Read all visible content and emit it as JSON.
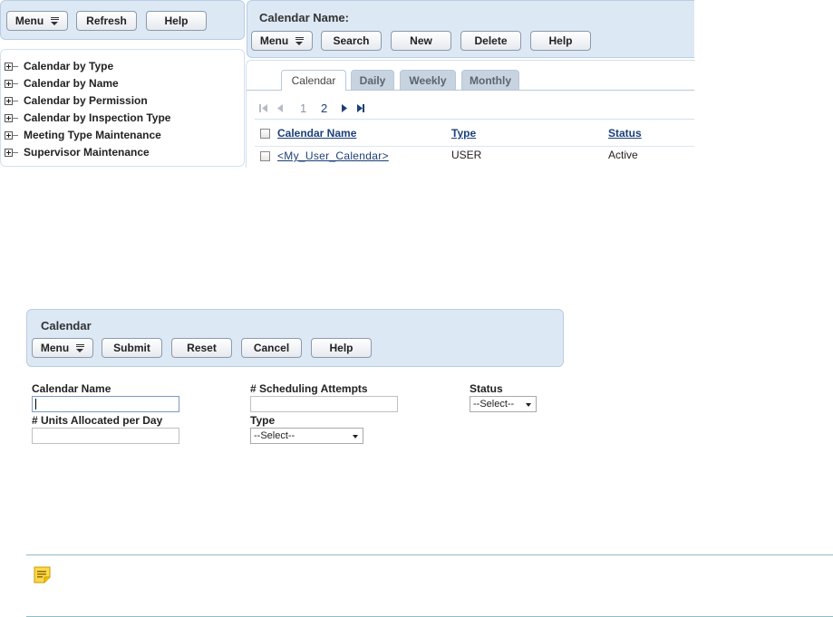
{
  "left_toolbar": {
    "menu_label": "Menu",
    "refresh_label": "Refresh",
    "help_label": "Help"
  },
  "tree": {
    "items": [
      {
        "label": "Calendar by Type"
      },
      {
        "label": "Calendar by Name"
      },
      {
        "label": "Calendar by Permission"
      },
      {
        "label": "Calendar by Inspection Type"
      },
      {
        "label": "Meeting Type Maintenance"
      },
      {
        "label": "Supervisor Maintenance"
      }
    ]
  },
  "top_panel": {
    "title": "Calendar Name:",
    "menu_label": "Menu",
    "search_label": "Search",
    "new_label": "New",
    "delete_label": "Delete",
    "help_label": "Help"
  },
  "tabs": [
    {
      "label": "Calendar",
      "active": true
    },
    {
      "label": "Daily"
    },
    {
      "label": "Weekly"
    },
    {
      "label": "Monthly"
    }
  ],
  "pager": {
    "page1": "1",
    "page2": "2",
    "current_page": 2
  },
  "table": {
    "headers": {
      "name": "Calendar Name",
      "type": "Type",
      "status": "Status"
    },
    "rows": [
      {
        "name": "<My_User_Calendar>",
        "type": "USER",
        "status": "Active"
      }
    ]
  },
  "form_panel": {
    "title": "Calendar",
    "menu_label": "Menu",
    "submit_label": "Submit",
    "reset_label": "Reset",
    "cancel_label": "Cancel",
    "help_label": "Help"
  },
  "form": {
    "calendar_name_label": "Calendar Name",
    "calendar_name_value": "",
    "scheduling_attempts_label": "# Scheduling Attempts",
    "scheduling_attempts_value": "",
    "status_label": "Status",
    "status_value": "--Select--",
    "units_label": "# Units Allocated per Day",
    "units_value": "",
    "type_label": "Type",
    "type_value": "--Select--"
  },
  "icons": {
    "note": "note-icon"
  },
  "colors": {
    "panel_bg": "#dde8f5",
    "link": "#1b3f7a",
    "note_line": "#8fbcc4"
  }
}
